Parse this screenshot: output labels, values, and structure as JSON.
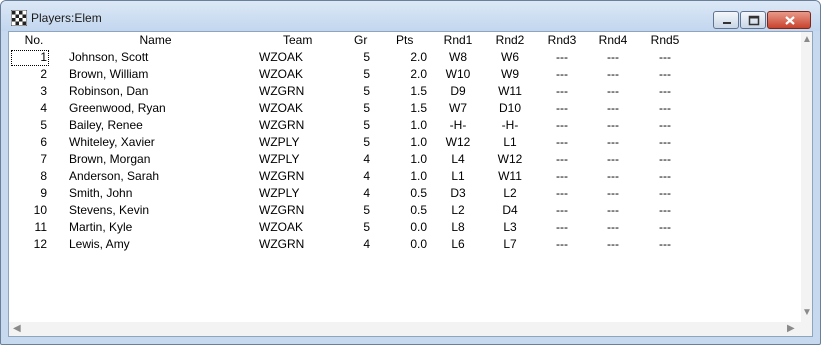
{
  "window": {
    "title": "Players:Elem"
  },
  "columns": {
    "no": "No.",
    "name": "Name",
    "team": "Team",
    "gr": "Gr",
    "pts": "Pts",
    "rnd1": "Rnd1",
    "rnd2": "Rnd2",
    "rnd3": "Rnd3",
    "rnd4": "Rnd4",
    "rnd5": "Rnd5"
  },
  "rows": [
    {
      "no": "1",
      "name": "Johnson, Scott",
      "team": "WZOAK",
      "gr": "5",
      "pts": "2.0",
      "rnd1": "W8",
      "rnd2": "W6",
      "rnd3": "---",
      "rnd4": "---",
      "rnd5": "---"
    },
    {
      "no": "2",
      "name": "Brown, William",
      "team": "WZOAK",
      "gr": "5",
      "pts": "2.0",
      "rnd1": "W10",
      "rnd2": "W9",
      "rnd3": "---",
      "rnd4": "---",
      "rnd5": "---"
    },
    {
      "no": "3",
      "name": "Robinson, Dan",
      "team": "WZGRN",
      "gr": "5",
      "pts": "1.5",
      "rnd1": "D9",
      "rnd2": "W11",
      "rnd3": "---",
      "rnd4": "---",
      "rnd5": "---"
    },
    {
      "no": "4",
      "name": "Greenwood, Ryan",
      "team": "WZOAK",
      "gr": "5",
      "pts": "1.5",
      "rnd1": "W7",
      "rnd2": "D10",
      "rnd3": "---",
      "rnd4": "---",
      "rnd5": "---"
    },
    {
      "no": "5",
      "name": "Bailey, Renee",
      "team": "WZGRN",
      "gr": "5",
      "pts": "1.0",
      "rnd1": "-H-",
      "rnd2": "-H-",
      "rnd3": "---",
      "rnd4": "---",
      "rnd5": "---"
    },
    {
      "no": "6",
      "name": "Whiteley, Xavier",
      "team": "WZPLY",
      "gr": "5",
      "pts": "1.0",
      "rnd1": "W12",
      "rnd2": "L1",
      "rnd3": "---",
      "rnd4": "---",
      "rnd5": "---"
    },
    {
      "no": "7",
      "name": "Brown, Morgan",
      "team": "WZPLY",
      "gr": "4",
      "pts": "1.0",
      "rnd1": "L4",
      "rnd2": "W12",
      "rnd3": "---",
      "rnd4": "---",
      "rnd5": "---"
    },
    {
      "no": "8",
      "name": "Anderson, Sarah",
      "team": "WZGRN",
      "gr": "4",
      "pts": "1.0",
      "rnd1": "L1",
      "rnd2": "W11",
      "rnd3": "---",
      "rnd4": "---",
      "rnd5": "---"
    },
    {
      "no": "9",
      "name": "Smith, John",
      "team": "WZPLY",
      "gr": "4",
      "pts": "0.5",
      "rnd1": "D3",
      "rnd2": "L2",
      "rnd3": "---",
      "rnd4": "---",
      "rnd5": "---"
    },
    {
      "no": "10",
      "name": "Stevens, Kevin",
      "team": "WZGRN",
      "gr": "5",
      "pts": "0.5",
      "rnd1": "L2",
      "rnd2": "D4",
      "rnd3": "---",
      "rnd4": "---",
      "rnd5": "---"
    },
    {
      "no": "11",
      "name": "Martin, Kyle",
      "team": "WZOAK",
      "gr": "5",
      "pts": "0.0",
      "rnd1": "L8",
      "rnd2": "L3",
      "rnd3": "---",
      "rnd4": "---",
      "rnd5": "---"
    },
    {
      "no": "12",
      "name": "Lewis, Amy",
      "team": "WZGRN",
      "gr": "4",
      "pts": "0.0",
      "rnd1": "L6",
      "rnd2": "L7",
      "rnd3": "---",
      "rnd4": "---",
      "rnd5": "---"
    }
  ],
  "icons": {
    "app": "chessboard-icon",
    "minimize": "minimize-icon",
    "maximize": "maximize-icon",
    "close": "close-icon"
  }
}
